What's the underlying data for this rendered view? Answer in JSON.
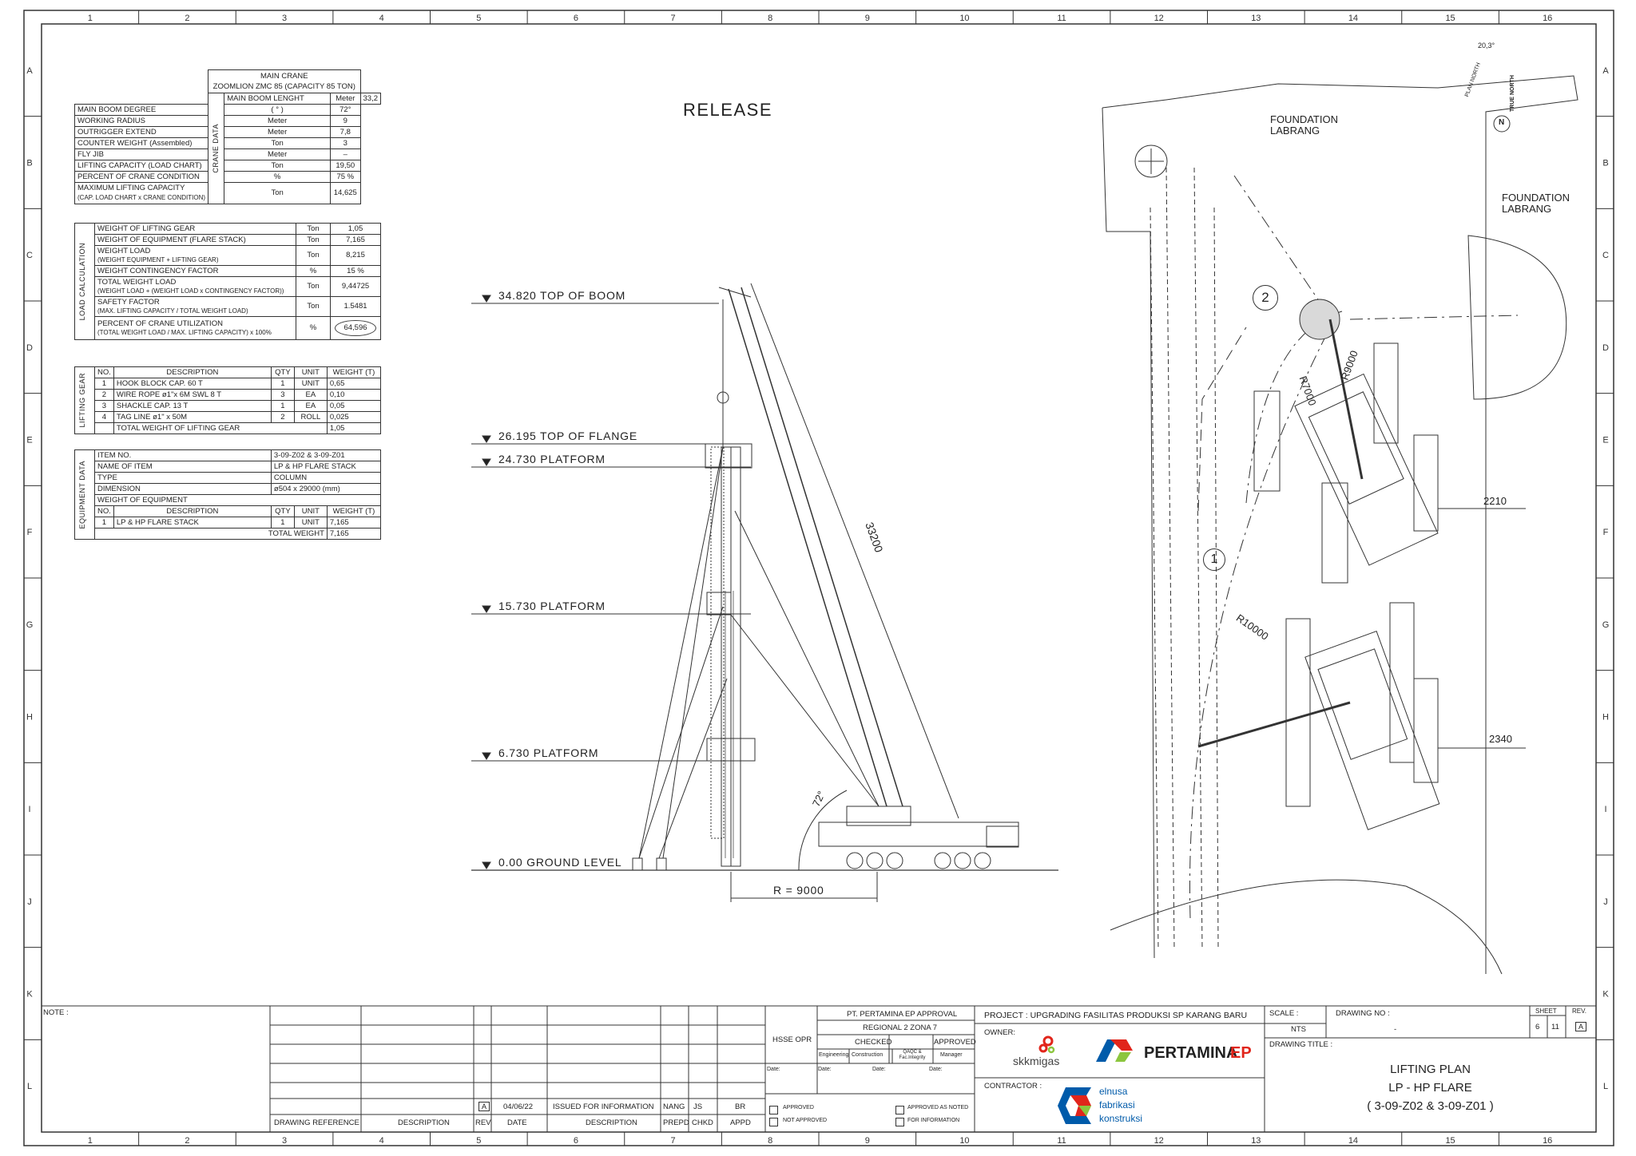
{
  "grid": {
    "cols": [
      "1",
      "2",
      "3",
      "4",
      "5",
      "6",
      "7",
      "8",
      "9",
      "10",
      "11",
      "12",
      "13",
      "14",
      "15",
      "16"
    ],
    "rows": [
      "A",
      "B",
      "C",
      "D",
      "E",
      "F",
      "G",
      "H",
      "I",
      "J",
      "K",
      "L"
    ]
  },
  "release_label": "RELEASE",
  "crane_data": {
    "section": "CRANE DATA",
    "header_line1": "MAIN CRANE",
    "header_line2": "ZOOMLION ZMC 85 (CAPACITY 85 TON)",
    "rows": [
      {
        "desc": "MAIN BOOM LENGHT",
        "unit": "Meter",
        "value": "33,2"
      },
      {
        "desc": "MAIN BOOM DEGREE",
        "unit": "( ° )",
        "value": "72°"
      },
      {
        "desc": "WORKING RADIUS",
        "unit": "Meter",
        "value": "9"
      },
      {
        "desc": "OUTRIGGER EXTEND",
        "unit": "Meter",
        "value": "7,8"
      },
      {
        "desc": "COUNTER WEIGHT (Assembled)",
        "unit": "Ton",
        "value": "3"
      },
      {
        "desc": "FLY JIB",
        "unit": "Meter",
        "value": "–"
      },
      {
        "desc": "LIFTING CAPACITY (LOAD CHART)",
        "unit": "Ton",
        "value": "19,50"
      },
      {
        "desc": "PERCENT OF CRANE CONDITION",
        "unit": "%",
        "value": "75 %"
      }
    ],
    "max_desc": "MAXIMUM LIFTING CAPACITY",
    "max_sub": "(CAP. LOAD CHART x CRANE CONDITION)",
    "max_unit": "Ton",
    "max_value": "14,625"
  },
  "load_calc": {
    "section": "LOAD CALCULATION",
    "rows": [
      {
        "desc": "WEIGHT OF LIFTING GEAR",
        "sub": "",
        "unit": "Ton",
        "value": "1,05"
      },
      {
        "desc": "WEIGHT OF EQUIPMENT (FLARE STACK)",
        "sub": "",
        "unit": "Ton",
        "value": "7,165"
      },
      {
        "desc": "WEIGHT LOAD",
        "sub": "(WEIGHT EQUIPMENT + LIFTING GEAR)",
        "unit": "Ton",
        "value": "8,215"
      },
      {
        "desc": "WEIGHT CONTINGENCY FACTOR",
        "sub": "",
        "unit": "%",
        "value": "15 %"
      },
      {
        "desc": "TOTAL WEIGHT LOAD",
        "sub": "(WEIGHT LOAD + (WEIGHT LOAD x CONTINGENCY FACTOR))",
        "unit": "Ton",
        "value": "9,44725"
      },
      {
        "desc": "SAFETY FACTOR",
        "sub": "(MAX. LIFTING CAPACITY / TOTAL WEIGHT LOAD)",
        "unit": "Ton",
        "value": "1.5481"
      },
      {
        "desc": "PERCENT OF CRANE UTILIZATION",
        "sub": "(TOTAL WEIGHT LOAD / MAX. LIFTING CAPACITY) x 100%",
        "unit": "%",
        "value": "64,596"
      }
    ]
  },
  "lifting_gear": {
    "section": "LIFTING GEAR",
    "headers": {
      "no": "NO.",
      "desc": "DESCRIPTION",
      "qty": "QTY",
      "unit": "UNIT",
      "weight": "WEIGHT (T)"
    },
    "rows": [
      {
        "no": "1",
        "desc": "HOOK BLOCK CAP. 60 T",
        "qty": "1",
        "unit": "UNIT",
        "weight": "0,65"
      },
      {
        "no": "2",
        "desc": "WIRE ROPE ø1\"x 6M SWL 8 T",
        "qty": "3",
        "unit": "EA",
        "weight": "0,10"
      },
      {
        "no": "3",
        "desc": "SHACKLE CAP. 13 T",
        "qty": "1",
        "unit": "EA",
        "weight": "0,05"
      },
      {
        "no": "4",
        "desc": "TAG LINE ø1\" x 50M",
        "qty": "2",
        "unit": "ROLL",
        "weight": "0,025"
      }
    ],
    "total_label": "TOTAL WEIGHT OF LIFTING GEAR",
    "total": "1,05"
  },
  "equipment_data": {
    "section": "EQUIPMENT DATA",
    "rows": [
      {
        "label": "ITEM NO.",
        "value": "3-09-Z02 & 3-09-Z01"
      },
      {
        "label": "NAME OF ITEM",
        "value": "LP & HP FLARE STACK"
      },
      {
        "label": "TYPE",
        "value": "COLUMN"
      },
      {
        "label": "DIMENSION",
        "value": "ø504 x 29000 (mm)"
      }
    ],
    "weight_heading": "WEIGHT OF EQUIPMENT",
    "headers": {
      "no": "NO.",
      "desc": "DESCRIPTION",
      "qty": "QTY",
      "unit": "UNIT",
      "weight": "WEIGHT (T)"
    },
    "item": {
      "no": "1",
      "desc": "LP & HP FLARE STACK",
      "qty": "1",
      "unit": "UNIT",
      "weight": "7,165"
    },
    "total_label": "TOTAL WEIGHT",
    "total": "7,165"
  },
  "elevation": {
    "levels": [
      "34.820 TOP OF BOOM",
      "26.195 TOP OF FLANGE",
      "24.730 PLATFORM",
      "15.730 PLATFORM",
      "6.730 PLATFORM",
      "0.00 GROUND LEVEL"
    ],
    "boom_length": "33200",
    "boom_angle": "72°",
    "radius": "R = 9000"
  },
  "plan": {
    "foundation1": [
      "FOUNDATION",
      "LABRANG"
    ],
    "foundation2": [
      "FOUNDATION",
      "LABRANG"
    ],
    "position1": "1",
    "position2": "2",
    "r7000": "R7000",
    "r9000": "R9000",
    "r10000": "R10000",
    "dim1": "2210",
    "dim2": "2340",
    "north_angle": "20,3°",
    "plan_north": "PLAN NORTH",
    "true_north": "TRUE NORTH",
    "north_letter": "N"
  },
  "title_block": {
    "note_label": "NOTE :",
    "drawing_reference": "DRAWING REFERENCE",
    "description": "DESCRIPTION",
    "rev": "REV",
    "date": "DATE",
    "prepd": "PREPD",
    "chkd": "CHKD",
    "appd": "APPD",
    "rev_mark": "A",
    "rev_date": "04/06/22",
    "rev_desc": "ISSUED FOR INFORMATION",
    "rev_prepd": "NANG",
    "rev_chkd": "JS",
    "rev_appd": "BR",
    "hsse": "HSSE OPR",
    "approval_title": "PT. PERTAMINA EP APPROVAL",
    "approval_region": "REGIONAL 2 ZONA 7",
    "checked": "CHECKED",
    "approved": "APPROVED",
    "engineering": "Engineering",
    "construction": "Construction",
    "qaqc": "QAQC & Fac.Integrity",
    "manager": "Manager",
    "date_label": "Date:",
    "chk_approved": "APPROVED",
    "chk_not_approved": "NOT APPROVED",
    "chk_approved_noted": "APPROVED AS NOTED",
    "chk_for_info": "FOR INFORMATION",
    "project": "PROJECT : UPGRADING FASILITAS PRODUKSI SP KARANG BARU",
    "owner_label": "OWNER:",
    "owner_logo1": "skkmigas",
    "owner_logo2": "PERTAMINA",
    "owner_logo2b": "EP",
    "contractor_label": "CONTRACTOR :",
    "contractor_l1": "elnusa",
    "contractor_l2": "fabrikasi",
    "contractor_l3": "konstruksi",
    "scale_label": "SCALE :",
    "scale": "NTS",
    "drawing_no_label": "DRAWING NO :",
    "drawing_no": "-",
    "sheet_label": "SHEET",
    "sheet": "6",
    "of": "11",
    "rev_label": "REV.",
    "rev_value": "A",
    "drawing_title_label": "DRAWING TITLE :",
    "title1": "LIFTING PLAN",
    "title2": "LP - HP FLARE",
    "title3": "( 3-09-Z02 & 3-09-Z01 )"
  },
  "colors": {
    "line": "#333333",
    "logo_red": "#e1251b",
    "logo_blue": "#005baa",
    "logo_green": "#8cc63f"
  }
}
